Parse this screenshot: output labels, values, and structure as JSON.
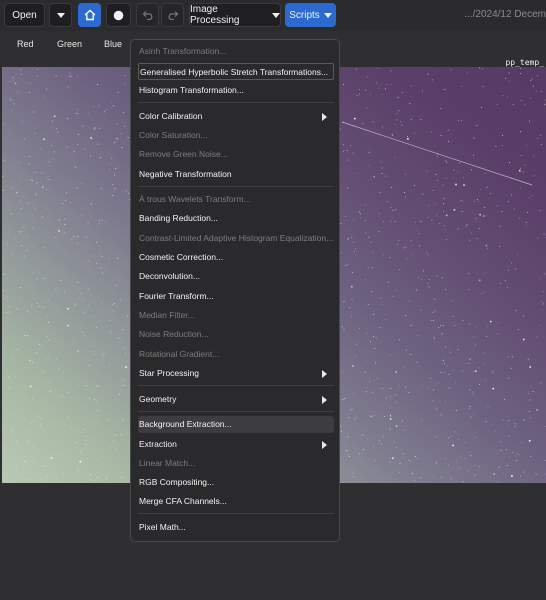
{
  "toolbar": {
    "open_label": "Open",
    "image_processing_label": "Image Processing",
    "scripts_label": "Scripts",
    "path_text": ".../2024/12 Decem",
    "icons": {
      "open_dropdown": "chevron-down-icon",
      "home": "home-icon",
      "record": "circle-icon",
      "undo": "undo-icon",
      "redo": "redo-icon"
    },
    "accent_color": "#2d6ad0"
  },
  "channels": [
    "Red",
    "Green",
    "Blue"
  ],
  "image": {
    "filename": "pp_temp_"
  },
  "menu": {
    "items": [
      {
        "label": "Asinh Transformation...",
        "enabled": false
      },
      {
        "label": "Generalised Hyperbolic Stretch Transformations...",
        "enabled": true,
        "focused": true
      },
      {
        "label": "Histogram Transformation...",
        "enabled": true
      },
      {
        "label": "Color Calibration",
        "enabled": true,
        "submenu": true
      },
      {
        "label": "Color Saturation...",
        "enabled": false
      },
      {
        "label": "Remove Green Noise...",
        "enabled": false
      },
      {
        "label": "Negative Transformation",
        "enabled": true
      },
      {
        "label": "À trous Wavelets Transform...",
        "enabled": false
      },
      {
        "label": "Banding Reduction...",
        "enabled": true
      },
      {
        "label": "Contrast-Limited Adaptive Histogram Equalization...",
        "enabled": false
      },
      {
        "label": "Cosmetic Correction...",
        "enabled": true
      },
      {
        "label": "Deconvolution...",
        "enabled": true
      },
      {
        "label": "Fourier Transform...",
        "enabled": true
      },
      {
        "label": "Median Filter...",
        "enabled": false
      },
      {
        "label": "Noise Reduction...",
        "enabled": false
      },
      {
        "label": "Rotational Gradient...",
        "enabled": false
      },
      {
        "label": "Star Processing",
        "enabled": true,
        "submenu": true
      },
      {
        "label": "Geometry",
        "enabled": true,
        "submenu": true
      },
      {
        "label": "Background Extraction...",
        "enabled": true,
        "highlighted": true
      },
      {
        "label": "Extraction",
        "enabled": true,
        "submenu": true
      },
      {
        "label": "Linear Match...",
        "enabled": false
      },
      {
        "label": "RGB Compositing...",
        "enabled": true
      },
      {
        "label": "Merge CFA Channels...",
        "enabled": true
      },
      {
        "label": "Pixel Math...",
        "enabled": true
      }
    ]
  }
}
